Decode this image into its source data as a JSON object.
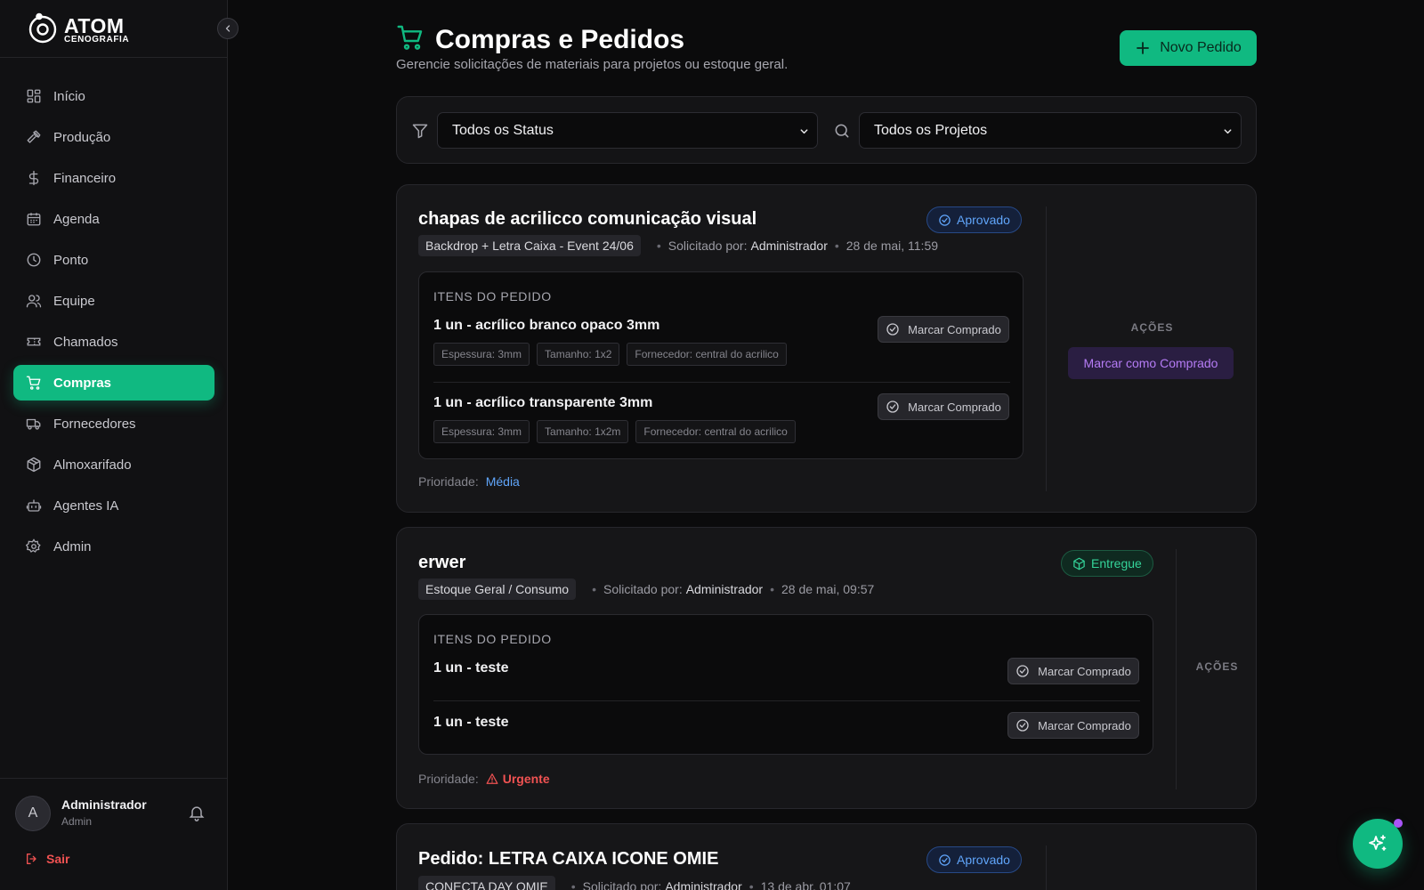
{
  "brand": {
    "name": "ATOM",
    "sub": "CENOGRAFIA"
  },
  "nav": [
    {
      "label": "Início",
      "icon": "dashboard-icon"
    },
    {
      "label": "Produção",
      "icon": "hammer-icon"
    },
    {
      "label": "Financeiro",
      "icon": "dollar-icon"
    },
    {
      "label": "Agenda",
      "icon": "calendar-icon"
    },
    {
      "label": "Ponto",
      "icon": "clock-icon"
    },
    {
      "label": "Equipe",
      "icon": "users-icon"
    },
    {
      "label": "Chamados",
      "icon": "ticket-icon"
    },
    {
      "label": "Compras",
      "icon": "cart-icon",
      "active": true
    },
    {
      "label": "Fornecedores",
      "icon": "truck-icon"
    },
    {
      "label": "Almoxarifado",
      "icon": "package-icon"
    },
    {
      "label": "Agentes IA",
      "icon": "bot-icon"
    },
    {
      "label": "Admin",
      "icon": "gear-icon"
    }
  ],
  "user": {
    "initial": "A",
    "name": "Administrador",
    "role": "Admin",
    "logout": "Sair"
  },
  "header": {
    "title": "Compras e Pedidos",
    "subtitle": "Gerencie solicitações de materiais para projetos ou estoque geral.",
    "new_button": "Novo Pedido"
  },
  "filters": {
    "status": "Todos os Status",
    "project": "Todos os Projetos"
  },
  "labels": {
    "items_header": "ITENS DO PEDIDO",
    "requested_by": "Solicitado por:",
    "priority": "Prioridade:",
    "mark_bought": "Marcar Comprado",
    "actions": "AÇÕES",
    "mark_all_bought": "Marcar como Comprado"
  },
  "orders": [
    {
      "title": "chapas de acrilicco comunicação visual",
      "status": "Aprovado",
      "project": "Backdrop + Letra Caixa - Event 24/06",
      "requester": "Administrador",
      "date": "28 de mai, 11:59",
      "items": [
        {
          "name": "1 un - acrílico branco opaco 3mm",
          "tags": [
            "Espessura: 3mm",
            "Tamanho: 1x2",
            "Fornecedor: central do acrilico"
          ]
        },
        {
          "name": "1 un - acrílico transparente 3mm",
          "tags": [
            "Espessura: 3mm",
            "Tamanho: 1x2m",
            "Fornecedor: central do acrilico"
          ]
        }
      ],
      "priority": "Média"
    },
    {
      "title": "erwer",
      "status": "Entregue",
      "project": "Estoque Geral / Consumo",
      "requester": "Administrador",
      "date": "28 de mai, 09:57",
      "items": [
        {
          "name": "1 un - teste"
        },
        {
          "name": "1 un - teste"
        }
      ],
      "priority": "Urgente"
    },
    {
      "title": "Pedido: LETRA CAIXA ICONE OMIE",
      "status": "Aprovado",
      "project": "CONECTA DAY OMIE",
      "requester": "Administrador",
      "date": "13 de abr, 01:07"
    }
  ],
  "colors": {
    "accent": "#10b981",
    "approved": "#60a5fa",
    "delivered": "#34d399",
    "urgent": "#f05252",
    "purple": "#b57cf5"
  }
}
